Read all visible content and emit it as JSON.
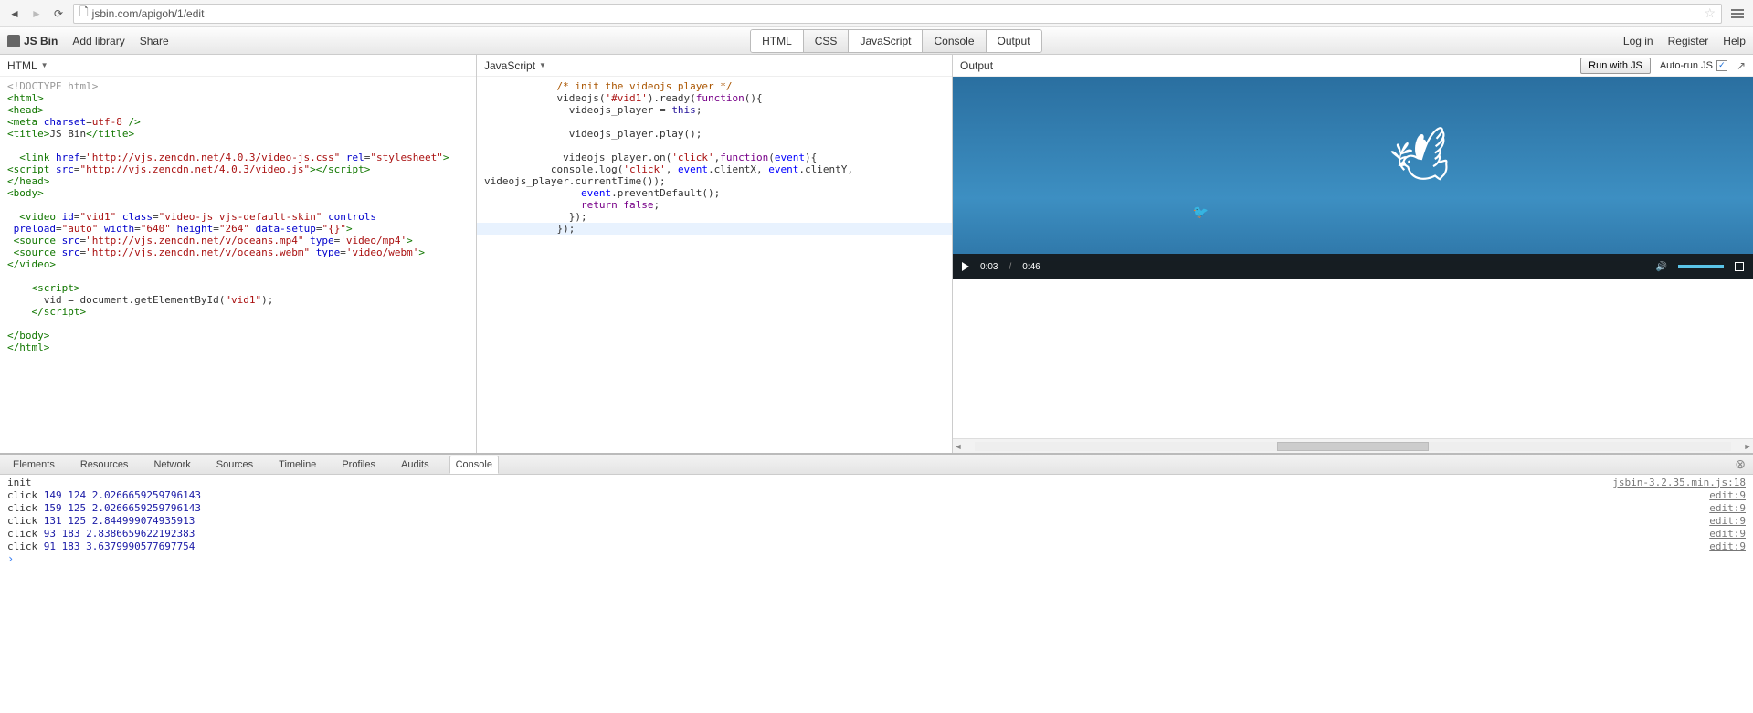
{
  "browser": {
    "url": "jsbin.com/apigoh/1/edit"
  },
  "toolbar": {
    "logo": "JS Bin",
    "addLibrary": "Add library",
    "share": "Share",
    "login": "Log in",
    "register": "Register",
    "help": "Help"
  },
  "panelTabs": {
    "html": "HTML",
    "css": "CSS",
    "javascript": "JavaScript",
    "console": "Console",
    "output": "Output"
  },
  "htmlPanel": {
    "title": "HTML"
  },
  "jsPanel": {
    "title": "JavaScript"
  },
  "outputPanel": {
    "title": "Output",
    "runBtn": "Run with JS",
    "autorun": "Auto-run JS"
  },
  "video": {
    "currentTime": "0:03",
    "duration": "0:46"
  },
  "devtools": {
    "tabs": {
      "elements": "Elements",
      "resources": "Resources",
      "network": "Network",
      "sources": "Sources",
      "timeline": "Timeline",
      "profiles": "Profiles",
      "audits": "Audits",
      "console": "Console"
    },
    "rows": [
      {
        "msg": "init",
        "src": "jsbin-3.2.35.min.js:18"
      },
      {
        "msg_prefix": "click ",
        "n1": "149",
        "n2": "124",
        "n3": "2.0266659259796143",
        "src": "edit:9"
      },
      {
        "msg_prefix": "click ",
        "n1": "159",
        "n2": "125",
        "n3": "2.0266659259796143",
        "src": "edit:9"
      },
      {
        "msg_prefix": "click ",
        "n1": "131",
        "n2": "125",
        "n3": "2.844999074935913",
        "src": "edit:9"
      },
      {
        "msg_prefix": "click ",
        "n1": "93",
        "n2": "183",
        "n3": "2.8386659622192383",
        "src": "edit:9"
      },
      {
        "msg_prefix": "click ",
        "n1": "91",
        "n2": "183",
        "n3": "3.6379990577697754",
        "src": "edit:9"
      }
    ]
  },
  "htmlCode": {
    "l1_a": "<!DOCTYPE html>",
    "l2_a": "<",
    "l2_b": "html",
    "l2_c": ">",
    "l3_a": "<",
    "l3_b": "head",
    "l3_c": ">",
    "l4_a": "<",
    "l4_b": "meta",
    "l4_c": " ",
    "l4_d": "charset",
    "l4_e": "=",
    "l4_f": "utf-8",
    "l4_g": " />",
    "l5_a": "<",
    "l5_b": "title",
    "l5_c": ">",
    "l5_d": "JS Bin",
    "l5_e": "</",
    "l5_f": "title",
    "l5_g": ">",
    "l6": "",
    "l7_a": "  <",
    "l7_b": "link",
    "l7_c": " ",
    "l7_d": "href",
    "l7_e": "=",
    "l7_f": "\"http://vjs.zencdn.net/4.0.3/video-js.css\"",
    "l7_g": " ",
    "l7_h": "rel",
    "l7_i": "=",
    "l7_j": "\"stylesheet\"",
    "l7_k": ">",
    "l8_a": "<",
    "l8_b": "script",
    "l8_c": " ",
    "l8_d": "src",
    "l8_e": "=",
    "l8_f": "\"http://vjs.zencdn.net/4.0.3/video.js\"",
    "l8_g": "></",
    "l8_h": "script",
    "l8_i": ">",
    "l9_a": "</",
    "l9_b": "head",
    "l9_c": ">",
    "l10_a": "<",
    "l10_b": "body",
    "l10_c": ">",
    "l11": "",
    "l12_a": "  <",
    "l12_b": "video",
    "l12_c": " ",
    "l12_d": "id",
    "l12_e": "=",
    "l12_f": "\"vid1\"",
    "l12_g": " ",
    "l12_h": "class",
    "l12_i": "=",
    "l12_j": "\"video-js vjs-default-skin\"",
    "l12_k": " ",
    "l12_l": "controls",
    "l13_a": " ",
    "l13_b": "preload",
    "l13_c": "=",
    "l13_d": "\"auto\"",
    "l13_e": " ",
    "l13_f": "width",
    "l13_g": "=",
    "l13_h": "\"640\"",
    "l13_i": " ",
    "l13_j": "height",
    "l13_k": "=",
    "l13_l": "\"264\"",
    "l13_m": " ",
    "l13_n": "data-setup",
    "l13_o": "=",
    "l13_p": "\"{}\"",
    "l13_q": ">",
    "l14_a": " <",
    "l14_b": "source",
    "l14_c": " ",
    "l14_d": "src",
    "l14_e": "=",
    "l14_f": "\"http://vjs.zencdn.net/v/oceans.mp4\"",
    "l14_g": " ",
    "l14_h": "type",
    "l14_i": "=",
    "l14_j": "'video/mp4'",
    "l14_k": ">",
    "l15_a": " <",
    "l15_b": "source",
    "l15_c": " ",
    "l15_d": "src",
    "l15_e": "=",
    "l15_f": "\"http://vjs.zencdn.net/v/oceans.webm\"",
    "l15_g": " ",
    "l15_h": "type",
    "l15_i": "=",
    "l15_j": "'video/webm'",
    "l15_k": ">",
    "l16_a": "</",
    "l16_b": "video",
    "l16_c": ">",
    "l17": "",
    "l18_a": "    <",
    "l18_b": "script",
    "l18_c": ">",
    "l19_a": "      vid = document.getElementById(",
    "l19_b": "\"vid1\"",
    "l19_c": ");",
    "l20_a": "    </",
    "l20_b": "script",
    "l20_c": ">",
    "l21": "",
    "l22_a": "</",
    "l22_b": "body",
    "l22_c": ">",
    "l23_a": "</",
    "l23_b": "html",
    "l23_c": ">"
  },
  "jsCode": {
    "l1_a": "            ",
    "l1_b": "/* init the videojs player */",
    "l2_a": "            videojs(",
    "l2_b": "'#vid1'",
    "l2_c": ").ready(",
    "l2_d": "function",
    "l2_e": "(){",
    "l3_a": "              videojs_player = ",
    "l3_b": "this",
    "l3_c": ";",
    "l4": "",
    "l5_a": "              videojs_player.play();",
    "l6": "",
    "l7_a": "             videojs_player.on(",
    "l7_b": "'click'",
    "l7_c": ",",
    "l7_d": "function",
    "l7_e": "(",
    "l7_f": "event",
    "l7_g": "){",
    "l8_a": "           console.log(",
    "l8_b": "'click'",
    "l8_c": ", ",
    "l8_d": "event",
    "l8_e": ".clientX, ",
    "l8_f": "event",
    "l8_g": ".clientY,\nvideojs_player.currentTime());",
    "l9_a": "                ",
    "l9_b": "event",
    "l9_c": ".preventDefault();",
    "l10_a": "                ",
    "l10_b": "return",
    "l10_c": " ",
    "l10_d": "false",
    "l10_e": ";",
    "l11_a": "              });",
    "l12": "",
    "l13_a": "            });"
  }
}
